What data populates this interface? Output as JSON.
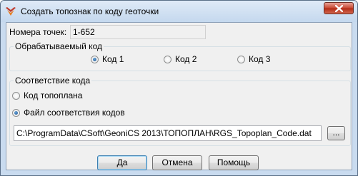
{
  "window": {
    "title": "Создать топознак по коду геоточки"
  },
  "points": {
    "label": "Номера точек:",
    "value": "1-652"
  },
  "processed_code": {
    "group_title": "Обрабатываемый код",
    "options": [
      {
        "label": "Код 1",
        "selected": true
      },
      {
        "label": "Код 2",
        "selected": false
      },
      {
        "label": "Код 3",
        "selected": false
      }
    ]
  },
  "code_mapping": {
    "group_title": "Соответствие кода",
    "options": [
      {
        "label": "Код топоплана",
        "selected": false
      },
      {
        "label": "Файл соответствия кодов",
        "selected": true
      }
    ],
    "file_path": "C:\\ProgramData\\CSoft\\GeoniCS 2013\\ТОПОПЛАН\\RGS_Topoplan_Code.dat",
    "browse_label": "..."
  },
  "buttons": {
    "ok": "Да",
    "cancel": "Отмена",
    "help": "Помощь"
  },
  "colors": {
    "accent": "#3c7fb1",
    "close_button": "#c7452f"
  }
}
